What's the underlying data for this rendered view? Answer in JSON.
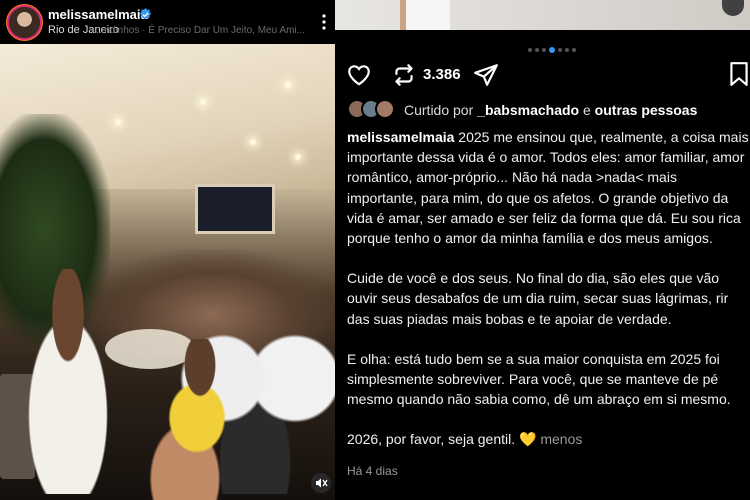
{
  "post": {
    "username": "melissamelmaia",
    "location": "Rio de Janeiro",
    "audio": "...ndinhos · É Preciso Dar Um Jeito, Meu Ami..."
  },
  "actions": {
    "repost_count": "3.386"
  },
  "likes": {
    "prefix": "Curtido por ",
    "first_user": "_babsmachado",
    "joiner": " e ",
    "others": "outras pessoas"
  },
  "caption": {
    "username": "melissamelmaia",
    "paragraph1": " 2025 me ensinou que, realmente, a coisa mais importante dessa vida é o amor. Todos eles: amor familiar, amor romântico, amor-próprio... Não há nada >nada< mais importante, para mim, do que os afetos. O grande objetivo da vida é amar, ser amado e ser feliz da forma que dá. Eu sou rica porque tenho o amor da minha família e dos meus amigos.",
    "paragraph2": "Cuide de você e dos seus. No final do dia, são eles que vão ouvir seus desabafos de um dia ruim, secar suas lágrimas, rir das suas piadas mais bobas e te apoiar de verdade.",
    "paragraph3": "E olha: está tudo bem se a sua maior conquista em 2025 foi simplesmente sobreviver. Para você, que se manteve de pé mesmo quando não sabia como, dê um abraço em si mesmo.",
    "paragraph4": "2026, por favor, seja gentil.",
    "heart": "💛",
    "less_link": "menos"
  },
  "timestamp": "Há 4 dias",
  "colors": {
    "verified": "#3897f0",
    "active_dot": "#3897f0",
    "heart_emoji": "#f5c518"
  },
  "icons": [
    "verified-badge-icon",
    "more-options-icon",
    "mute-icon",
    "heart-icon",
    "repost-icon",
    "share-icon",
    "bookmark-icon"
  ]
}
